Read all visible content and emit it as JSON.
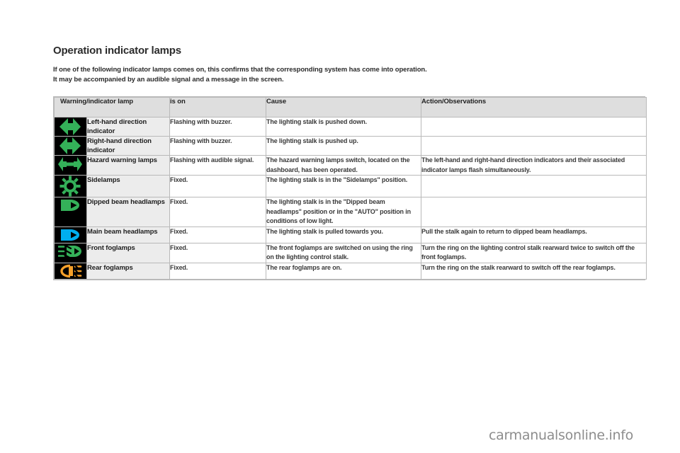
{
  "page": {
    "title": "Operation indicator lamps",
    "intro_line_1": "If one of the following indicator lamps comes on, this confirms that the corresponding system has come into operation.",
    "intro_line_2": "It may be accompanied by an audible signal and a message in the screen.",
    "watermark": "carmanualsonline.info"
  },
  "table": {
    "headers": {
      "lamp": "Warning/indicator lamp",
      "is_on": "is on",
      "cause": "Cause",
      "action": "Action/Observations"
    },
    "rows": [
      {
        "icon": "left-direction-indicator-icon",
        "icon_color": "#34b159",
        "label": "Left-hand direction indicator",
        "is_on": "Flashing with buzzer.",
        "cause": "The lighting stalk is pushed down.",
        "action": ""
      },
      {
        "icon": "right-direction-indicator-icon",
        "icon_color": "#34b159",
        "label": "Right-hand direction indicator",
        "is_on": "Flashing with buzzer.",
        "cause": "The lighting stalk is pushed up.",
        "action": ""
      },
      {
        "icon": "hazard-warning-lamps-icon",
        "icon_color": "#34b159",
        "label": "Hazard warning lamps",
        "is_on": "Flashing with audible signal.",
        "cause": "The hazard warning lamps switch, located on the dashboard, has been operated.",
        "action": "The left-hand and right-hand direction indicators and their associated indicator lamps flash simultaneously."
      },
      {
        "icon": "sidelamps-icon",
        "icon_color": "#34b159",
        "label": "Sidelamps",
        "is_on": "Fixed.",
        "cause": "The lighting stalk is in the \"Sidelamps\" position.",
        "action": ""
      },
      {
        "icon": "dipped-beam-headlamps-icon",
        "icon_color": "#34b159",
        "label": "Dipped beam headlamps",
        "is_on": "Fixed.",
        "cause": "The lighting stalk is in the \"Dipped beam headlamps\" position or in the \"AUTO\" position in conditions of low light.",
        "action": ""
      },
      {
        "icon": "main-beam-headlamps-icon",
        "icon_color": "#00aeef",
        "label": "Main beam headlamps",
        "is_on": "Fixed.",
        "cause": "The lighting stalk is pulled towards you.",
        "action": "Pull the stalk again to return to dipped beam headlamps."
      },
      {
        "icon": "front-foglamps-icon",
        "icon_color": "#34b159",
        "label": "Front foglamps",
        "is_on": "Fixed.",
        "cause": "The front foglamps are switched on using the ring on the lighting control stalk.",
        "action": "Turn the ring on the lighting control stalk rearward twice to switch off the front foglamps."
      },
      {
        "icon": "rear-foglamps-icon",
        "icon_color": "#f5a02a",
        "label": "Rear foglamps",
        "is_on": "Fixed.",
        "cause": "The rear foglamps are on.",
        "action": "Turn the ring on the stalk rearward to switch off the rear foglamps."
      }
    ]
  }
}
